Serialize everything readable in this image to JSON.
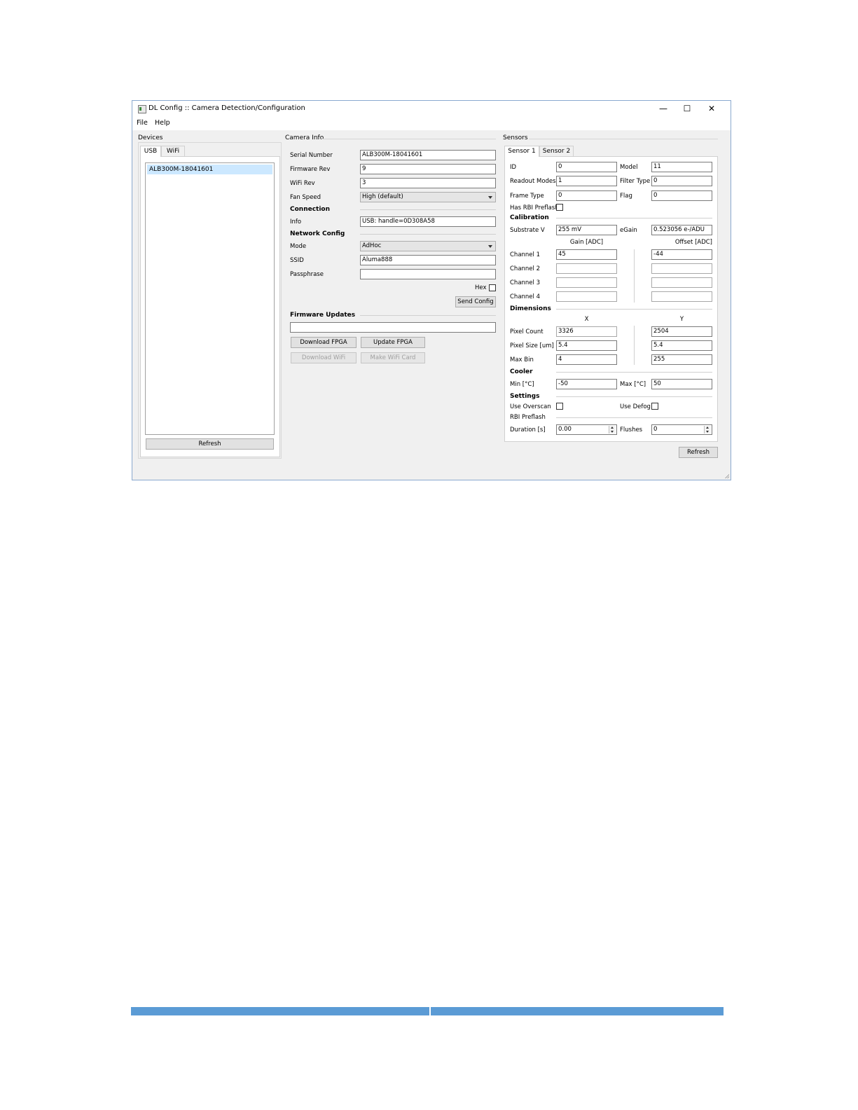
{
  "window": {
    "title": "DL Config :: Camera Detection/Configuration",
    "minimize": "—",
    "maximize": "☐",
    "close": "✕"
  },
  "menu": [
    "File",
    "Help"
  ],
  "devices": {
    "title": "Devices",
    "tabs": [
      "USB",
      "WiFi"
    ],
    "active_tab": "USB",
    "items": [
      "ALB300M-18041601"
    ],
    "refresh": "Refresh"
  },
  "camera_info": {
    "title": "Camera Info",
    "fields": {
      "serial_number": {
        "label": "Serial Number",
        "value": "ALB300M-18041601"
      },
      "firmware_rev": {
        "label": "Firmware Rev",
        "value": "9"
      },
      "wifi_rev": {
        "label": "WiFi Rev",
        "value": "3"
      },
      "fan_speed": {
        "label": "Fan Speed",
        "value": "High (default)"
      }
    },
    "connection": {
      "header": "Connection",
      "info_label": "Info",
      "info_value": "USB: handle=0D308A58"
    },
    "network": {
      "header": "Network Config",
      "mode_label": "Mode",
      "mode_value": "AdHoc",
      "ssid_label": "SSID",
      "ssid_value": "Aluma888",
      "passphrase_label": "Passphrase",
      "passphrase_value": "",
      "hex_label": "Hex",
      "send_config": "Send Config"
    },
    "firmware": {
      "header": "Firmware Updates",
      "path_value": "",
      "download_fpga": "Download FPGA",
      "update_fpga": "Update FPGA",
      "download_wifi": "Download WiFi",
      "make_wifi_card": "Make WiFi Card"
    }
  },
  "sensors": {
    "title": "Sensors",
    "tabs": [
      "Sensor 1",
      "Sensor 2"
    ],
    "active_tab": "Sensor 1",
    "id": {
      "label": "ID",
      "value": "0"
    },
    "model": {
      "label": "Model",
      "value": "11"
    },
    "readout_modes": {
      "label": "Readout Modes",
      "value": "1"
    },
    "filter_type": {
      "label": "Filter Type",
      "value": "0"
    },
    "frame_type": {
      "label": "Frame Type",
      "value": "0"
    },
    "flag": {
      "label": "Flag",
      "value": "0"
    },
    "has_rbi_preflash": {
      "label": "Has RBI Preflash",
      "checked": false
    },
    "calibration": {
      "header": "Calibration",
      "substrate_label": "Substrate V",
      "substrate_value": "255 mV",
      "egain_label": "eGain",
      "egain_value": "0.523056 e-/ADU",
      "gain_header": "Gain [ADC]",
      "offset_header": "Offset [ADC]",
      "channels": [
        {
          "label": "Channel 1",
          "gain": "45",
          "offset": "-44"
        },
        {
          "label": "Channel 2",
          "gain": "",
          "offset": ""
        },
        {
          "label": "Channel 3",
          "gain": "",
          "offset": ""
        },
        {
          "label": "Channel 4",
          "gain": "",
          "offset": ""
        }
      ]
    },
    "dimensions": {
      "header": "Dimensions",
      "x_header": "X",
      "y_header": "Y",
      "rows": [
        {
          "label": "Pixel Count",
          "x": "3326",
          "y": "2504"
        },
        {
          "label": "Pixel Size [um]",
          "x": "5.4",
          "y": "5.4"
        },
        {
          "label": "Max Bin",
          "x": "4",
          "y": "255"
        }
      ]
    },
    "cooler": {
      "header": "Cooler",
      "min_label": "Min [°C]",
      "min_value": "-50",
      "max_label": "Max [°C]",
      "max_value": "50"
    },
    "settings": {
      "header": "Settings",
      "use_overscan": "Use Overscan",
      "use_defog": "Use Defog",
      "rbi_preflash": "RBI Preflash",
      "duration_label": "Duration [s]",
      "duration_value": "0.00",
      "flushes_label": "Flushes",
      "flushes_value": "0"
    },
    "refresh": "Refresh"
  },
  "colors": {
    "accent": "#5b9bd5",
    "selection": "#cce8ff",
    "window_bg": "#f0f0f0"
  }
}
